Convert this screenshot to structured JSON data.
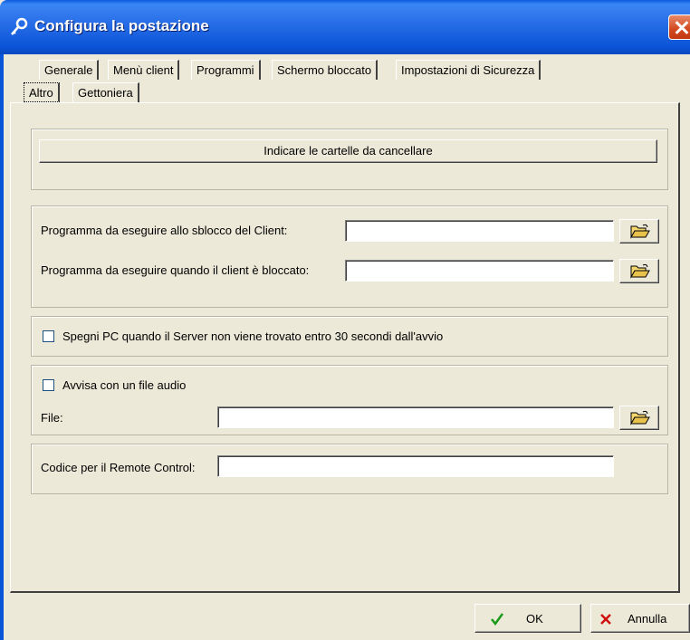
{
  "window": {
    "title": "Configura la postazione",
    "icon": "key-icon"
  },
  "tabs": {
    "row1": [
      {
        "label": "Generale"
      },
      {
        "label": "Menù client"
      },
      {
        "label": "Programmi"
      },
      {
        "label": "Schermo bloccato"
      },
      {
        "label": "Impostazioni di Sicurezza"
      }
    ],
    "row2": [
      {
        "label": "Altro",
        "active": true
      },
      {
        "label": "Gettoniera"
      }
    ]
  },
  "altro": {
    "delete_folders_button": "Indicare le cartelle da cancellare",
    "programs": {
      "unlock_label": "Programma da eseguire allo sblocco del Client:",
      "unlock_value": "",
      "locked_label": "Programma da eseguire quando il client è bloccato:",
      "locked_value": ""
    },
    "shutdown": {
      "label": "Spegni PC quando il Server non viene trovato entro 30 secondi dall'avvio",
      "checked": false
    },
    "audio": {
      "checkbox_label": "Avvisa con un file audio",
      "checked": false,
      "file_label": "File:",
      "file_value": ""
    },
    "remote": {
      "label": "Codice per il Remote Control:",
      "value": ""
    }
  },
  "footer": {
    "ok_label": "OK",
    "cancel_label": "Annulla"
  },
  "colors": {
    "titlebar": "#0a55d8",
    "dialog_bg": "#ece9d8",
    "ok_check": "#1a9a1a",
    "cancel_x": "#d01010"
  }
}
